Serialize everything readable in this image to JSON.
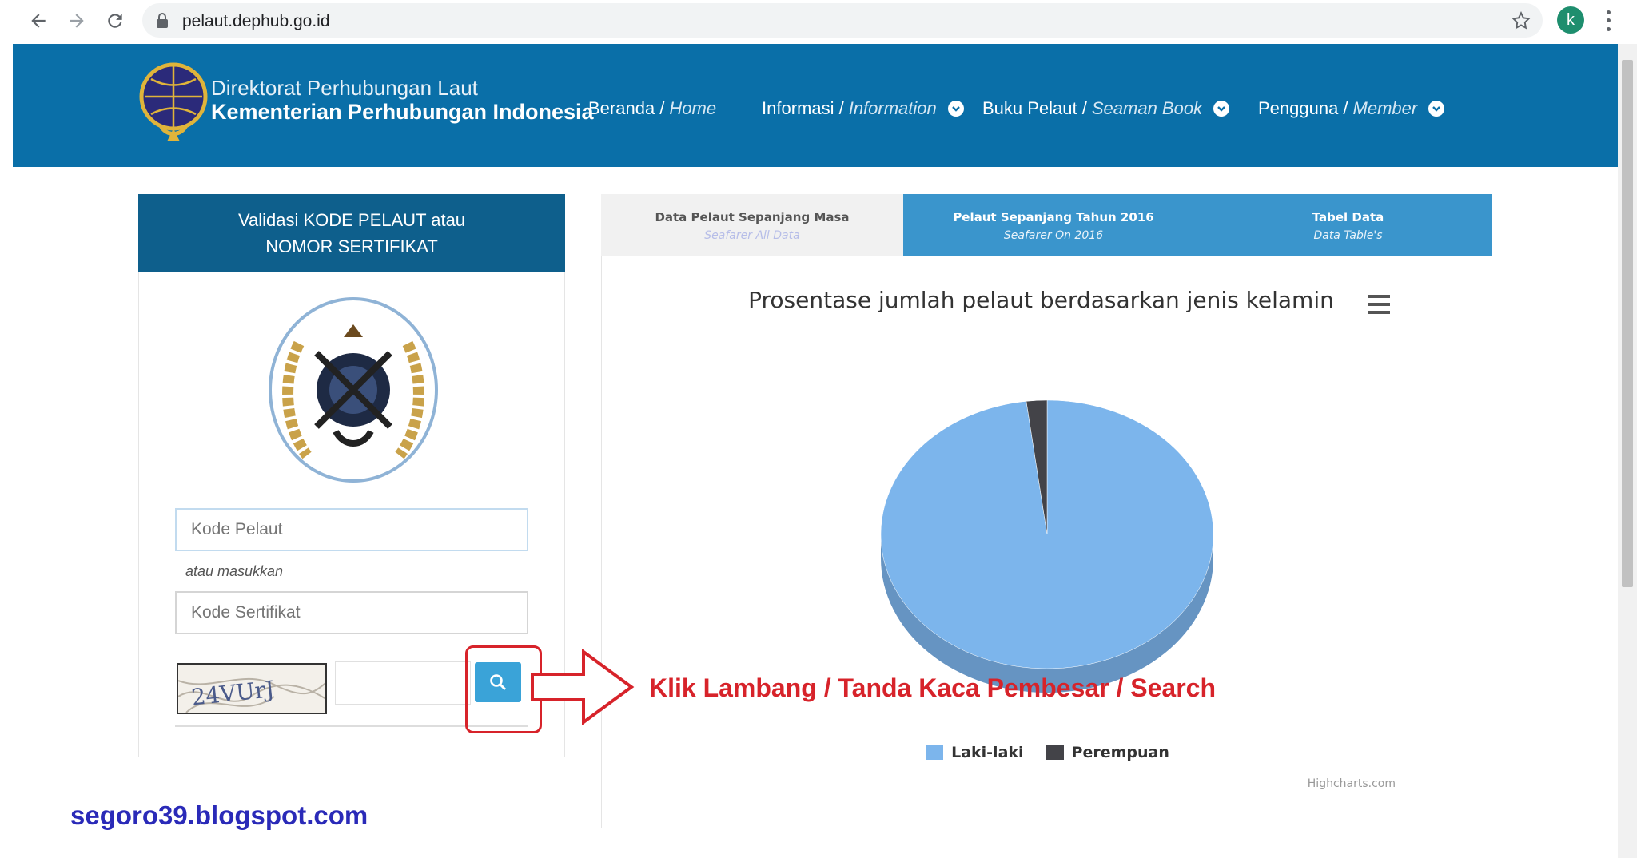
{
  "browser": {
    "url": "pelaut.dephub.go.id",
    "profile_initial": "k"
  },
  "site": {
    "org_line1": "Direktorat Perhubungan Laut",
    "org_line2": "Kementerian Perhubungan Indonesia",
    "nav": [
      {
        "label": "Beranda /",
        "label_en": "Home",
        "has_menu": false
      },
      {
        "label": "Informasi /",
        "label_en": "Information",
        "has_menu": true
      },
      {
        "label": "Buku Pelaut /",
        "label_en": "Seaman Book",
        "has_menu": true
      },
      {
        "label": "Pengguna /",
        "label_en": "Member",
        "has_menu": true
      }
    ]
  },
  "validation": {
    "title_line1": "Validasi KODE PELAUT atau",
    "title_line2": "NOMOR SERTIFIKAT",
    "kode_pelaut_placeholder": "Kode Pelaut",
    "hint": "atau masukkan",
    "kode_sertifikat_placeholder": "Kode Sertifikat",
    "captcha_text": "24VUrJ"
  },
  "tabs": [
    {
      "title": "Data Pelaut Sepanjang Masa",
      "subtitle": "Seafarer All Data",
      "active": false
    },
    {
      "title": "Pelaut Sepanjang Tahun 2016",
      "subtitle": "Seafarer On 2016",
      "active": true
    },
    {
      "title": "Tabel Data",
      "subtitle": "Data Table's",
      "active": false
    }
  ],
  "chart_data": {
    "type": "pie",
    "title": "Prosentase jumlah pelaut berdasarkan jenis kelamin",
    "series": [
      {
        "name": "Laki-laki",
        "value": 98,
        "color": "#7cb5ec"
      },
      {
        "name": "Perempuan",
        "value": 2,
        "color": "#434348"
      }
    ],
    "legend_position": "bottom",
    "credits": "Highcharts.com"
  },
  "annotation": {
    "text": "Klik Lambang / Tanda Kaca Pembesar / Search",
    "color": "#d7232a"
  },
  "watermark": "segoro39.blogspot.com"
}
